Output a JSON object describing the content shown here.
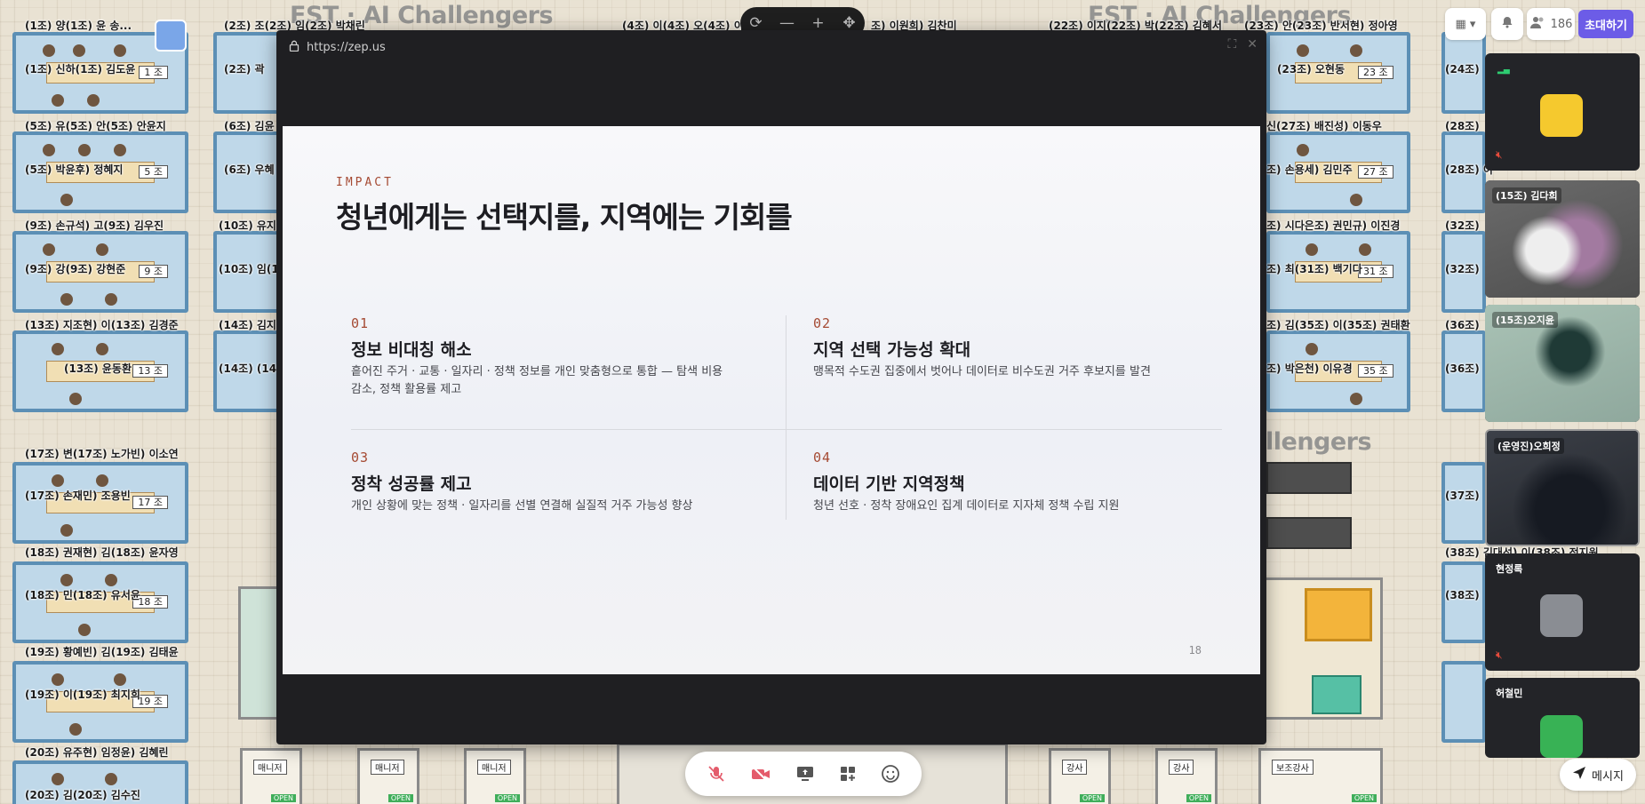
{
  "map": {
    "brand_text": "EST · AI Challengers",
    "brand_text_lower": "llengers",
    "labels_left": [
      "(1조) 양(1조) 윤 송...",
      "(1조) 신하(1조) 김도윤",
      "(5조) 유(5조) 안(5조) 안윤지",
      "(5조) 박윤후) 정혜지",
      "(9조) 손규석) 고(9조) 김우진",
      "(9조) 강(9조) 강현준",
      "(13조) 지조현) 이(13조) 김경준",
      "(13조) 윤동환",
      "(17조) 변(17조) 노가빈) 이소연",
      "(17조) 손재민) 조용빈",
      "(18조) 권재현) 김(18조) 윤자영",
      "(18조) 민(18조) 유서윤",
      "(19조) 황예빈) 김(19조) 김태윤",
      "(19조) 이(19조) 최지희",
      "(20조) 유주현) 임정윤) 김혜린",
      "(20조) 김(20조) 김수진"
    ],
    "labels_mid": [
      "(2조) 조(2조) 임(2조) 박채린",
      "(2조) 곽",
      "(6조) 김윤",
      "(6조) 우혜",
      "(10조) 유지",
      "(10조) 임(10",
      "(14조) 김지",
      "(14조) (14"
    ],
    "labels_top": [
      "(4조) 이(4조) 오(4조) 이",
      "조) 이원희) 김찬미",
      "(22조) 이지(22조) 박(22조) 김혜서",
      "(23조) 안(23조) 반서현) 정아영"
    ],
    "labels_right": [
      "(23조) 오현동",
      "신(27조) 배진성) 이동우",
      "조) 손용세) 김민주",
      "조) 시다은조) 권민규) 이진경",
      "조) 최(31조) 백기다",
      "조) 김(35조) 이(35조) 권태환",
      "조) 박은천) 이유경",
      "(24조)",
      "(28조)",
      "(28조) 이",
      "(32조)",
      "(32조)",
      "(36조)",
      "(36조)",
      "(37조)",
      "(38조) 김대선) 이(38조) 전지원",
      "(38조)"
    ],
    "room_signs": [
      "1 조",
      "5 조",
      "9 조",
      "13 조",
      "17 조",
      "18 조",
      "19 조",
      "23 조",
      "27 조",
      "31 조",
      "35 조"
    ],
    "room_tags": [
      "매니저",
      "매니저",
      "매니저",
      "강사",
      "강사",
      "보조강사"
    ],
    "door_label": "OPEN"
  },
  "top_controls": {
    "icons": [
      "refresh-icon",
      "zoom-out-icon",
      "zoom-in-icon",
      "move-icon"
    ],
    "zoom_out": "—",
    "zoom_in": "+"
  },
  "popup": {
    "url": "https://zep.us",
    "slide": {
      "eyebrow": "IMPACT",
      "title": "청년에게는 선택지를, 지역에는 기회를",
      "items": [
        {
          "num": "01",
          "heading": "정보 비대칭 해소",
          "desc": "흩어진 주거 · 교통 · 일자리 · 정책 정보를 개인 맞춤형으로 통합 — 탐색 비용 감소, 정책 활용률 제고"
        },
        {
          "num": "02",
          "heading": "지역 선택 가능성 확대",
          "desc": "맹목적 수도권 집중에서 벗어나 데이터로 비수도권 거주 후보지를 발견"
        },
        {
          "num": "03",
          "heading": "정착 성공률 제고",
          "desc": "개인 상황에 맞는 정책 · 일자리를 선별 연결해 실질적 거주 가능성 향상"
        },
        {
          "num": "04",
          "heading": "데이터 기반 지역정책",
          "desc": "청년 선호 · 정착 장애요인 집계 데이터로 지자체 정책 수립 지원"
        }
      ],
      "page_number": "18"
    }
  },
  "top_right": {
    "participant_count": "186",
    "invite_label": "초대하기"
  },
  "video_tiles": [
    {
      "name": "",
      "type": "avatar",
      "mic_muted": true
    },
    {
      "name": "(15조) 김다희",
      "type": "camera"
    },
    {
      "name": "(15조)오지윤",
      "type": "camera"
    },
    {
      "name": "(운영진)오희정",
      "type": "camera"
    },
    {
      "name": "현정록",
      "type": "avatar",
      "mic_muted": true
    },
    {
      "name": "허철민",
      "type": "avatar"
    }
  ],
  "bottom_bar": {
    "icons": [
      "mic-off-icon",
      "camera-off-icon",
      "screen-share-icon",
      "apps-icon",
      "emoji-icon"
    ]
  },
  "message_button": {
    "label": "메시지"
  },
  "colors": {
    "accent": "#6c5ce7",
    "slide_accent": "#a54a33"
  }
}
